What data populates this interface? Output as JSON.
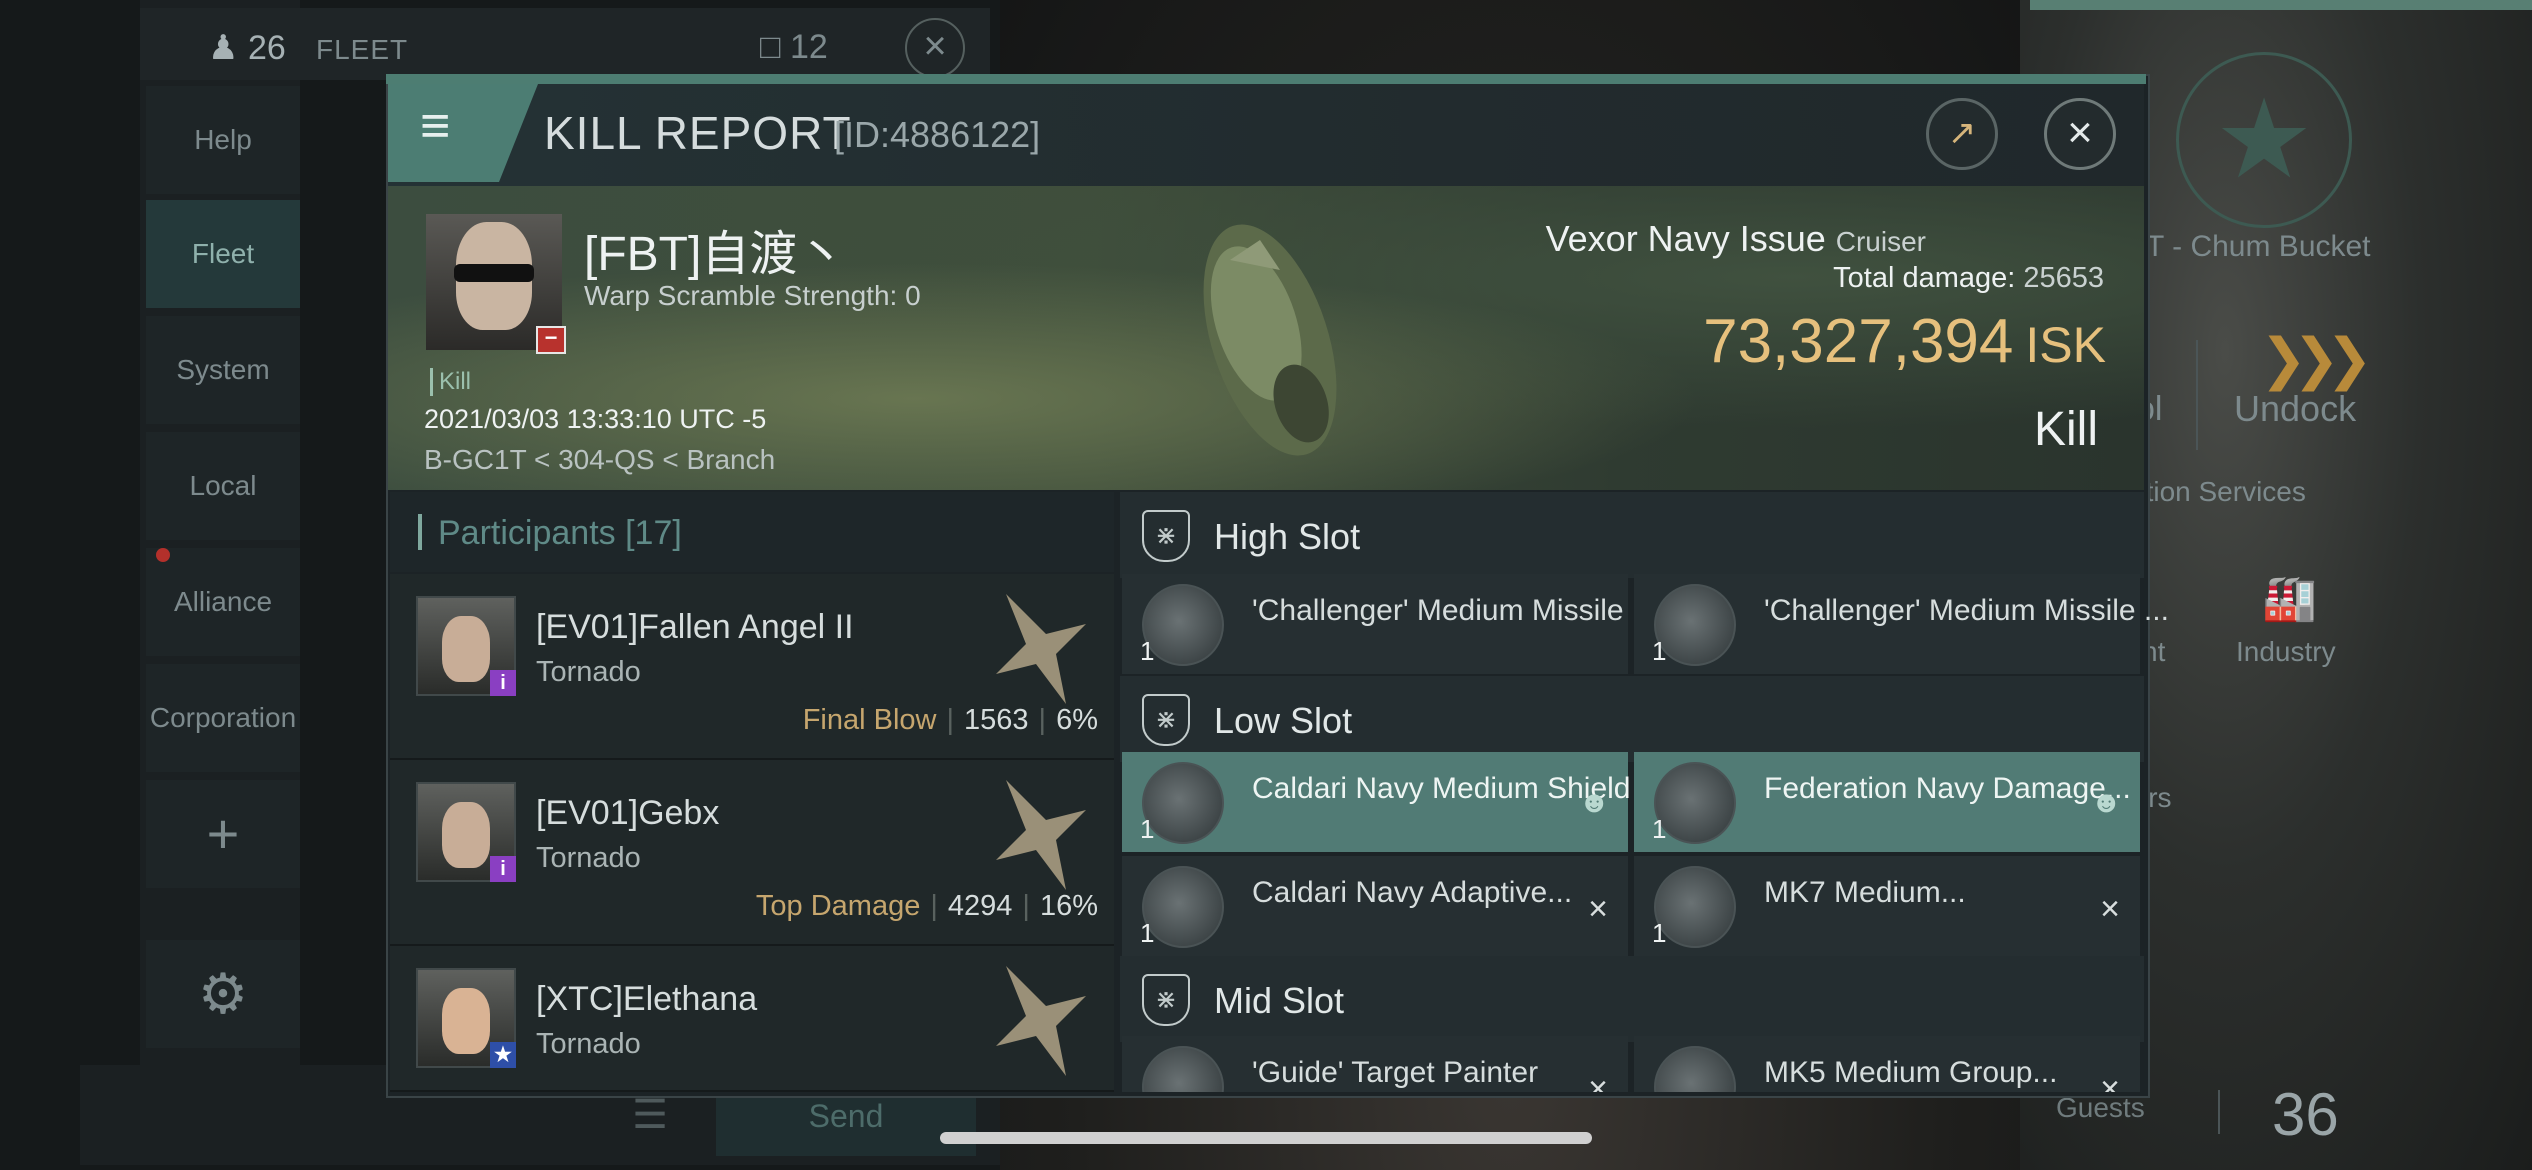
{
  "background": {
    "fleet_count": "26",
    "fleet_title": "FLEET",
    "fleet_square_count": "12",
    "sidebar": [
      "Help",
      "Fleet",
      "System",
      "Local",
      "Alliance",
      "Corporation"
    ],
    "chat_send": "Send",
    "right_station_name": "T - Chum Bucket",
    "right_undock": "Undock",
    "right_tool_partial": "ol",
    "right_station_services": "ation Services",
    "right_industry": "Industry",
    "right_partial_nt": "nt",
    "right_partial_irs": "irs",
    "right_guests": "Guests",
    "right_guests_count": "36"
  },
  "header": {
    "title": "KILL REPORT",
    "id": "[ID:4886122]"
  },
  "victim": {
    "name": "[FBT]自渡丶",
    "warp_scramble": "Warp Scramble Strength: 0",
    "tag": "Kill",
    "time": "2021/03/03 13:33:10 UTC -5",
    "location": "B-GC1T < 304-QS < Branch",
    "ship_name": "Vexor Navy Issue",
    "ship_class": "Cruiser",
    "total_damage_label": "Total damage:",
    "total_damage": "25653",
    "isk_value": "73,327,394",
    "isk_unit": "ISK",
    "result": "Kill"
  },
  "participants": {
    "label": "Participants",
    "count": "[17]",
    "rows": [
      {
        "name": "[EV01]Fallen Angel II",
        "ship": "Tornado",
        "tag": "Final Blow",
        "damage": "1563",
        "percent": "6%"
      },
      {
        "name": "[EV01]Gebx",
        "ship": "Tornado",
        "tag": "Top Damage",
        "damage": "4294",
        "percent": "16%"
      },
      {
        "name": "[XTC]Elethana",
        "ship": "Tornado"
      }
    ]
  },
  "slots": {
    "high": {
      "label": "High Slot",
      "modules": [
        {
          "name": "'Challenger' Medium Missile ...",
          "qty": "1"
        },
        {
          "name": "'Challenger' Medium Missile ...",
          "qty": "1"
        }
      ]
    },
    "low": {
      "label": "Low Slot",
      "modules": [
        {
          "name": "Caldari Navy Medium Shield ...",
          "qty": "1"
        },
        {
          "name": "Federation Navy Damage...",
          "qty": "1"
        },
        {
          "name": "Caldari Navy Adaptive...",
          "qty": "1"
        },
        {
          "name": "MK7 Medium...",
          "qty": "1"
        }
      ]
    },
    "mid": {
      "label": "Mid Slot",
      "modules": [
        {
          "name": "'Guide' Target Painter"
        },
        {
          "name": "MK5 Medium Group..."
        }
      ]
    }
  },
  "colors": {
    "accent": "#4c7d73",
    "isk_gold": "#e6c07d",
    "highlight_row": "#517b75"
  }
}
